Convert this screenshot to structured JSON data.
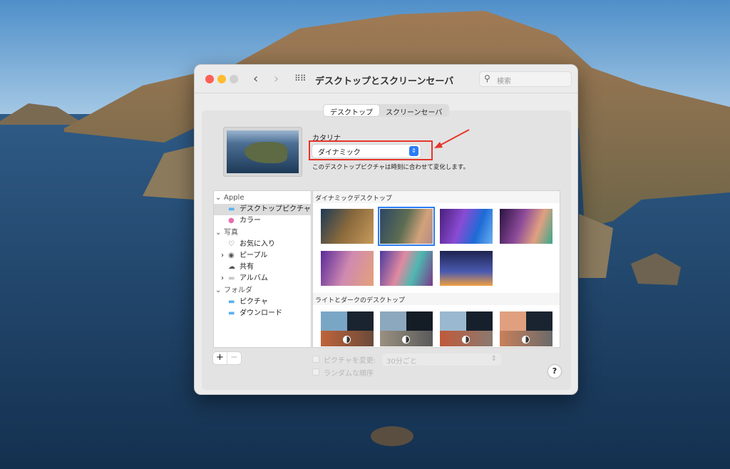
{
  "window": {
    "title": "デスクトップとスクリーンセーバ",
    "search_placeholder": "検索"
  },
  "tabs": [
    {
      "label": "デスクトップ",
      "active": true
    },
    {
      "label": "スクリーンセーバ",
      "active": false
    }
  ],
  "picture": {
    "name": "カタリナ",
    "mode": "ダイナミック",
    "description": "このデスクトップピクチャは時刻に合わせて変化します。"
  },
  "sidebar": {
    "items": [
      {
        "label": "Apple",
        "type": "group",
        "icon": "chevron-down-icon"
      },
      {
        "label": "デスクトップピクチャ",
        "type": "item",
        "icon": "folder-icon",
        "selected": true
      },
      {
        "label": "カラー",
        "type": "item",
        "icon": "color-wheel-icon"
      },
      {
        "label": "写真",
        "type": "group",
        "icon": "chevron-down-icon"
      },
      {
        "label": "お気に入り",
        "type": "item",
        "icon": "heart-icon"
      },
      {
        "label": "ピープル",
        "type": "item",
        "icon": "person-icon",
        "expandable": true
      },
      {
        "label": "共有",
        "type": "item",
        "icon": "cloud-icon"
      },
      {
        "label": "アルバム",
        "type": "item",
        "icon": "album-folder-icon",
        "expandable": true
      },
      {
        "label": "フォルダ",
        "type": "group",
        "icon": "chevron-down-icon"
      },
      {
        "label": "ピクチャ",
        "type": "item",
        "icon": "folder-icon"
      },
      {
        "label": "ダウンロード",
        "type": "item",
        "icon": "folder-icon"
      }
    ]
  },
  "sections": {
    "dynamic": "ダイナミックデスクトップ",
    "light_dark": "ライトとダークのデスクトップ"
  },
  "bottom": {
    "add": "+",
    "remove": "−",
    "change_picture": "ピクチャを変更:",
    "interval": "30分ごと",
    "random": "ランダムな順序",
    "help": "?"
  },
  "colors": {
    "accent": "#2a7cf6",
    "highlight_box": "#e5352b"
  }
}
